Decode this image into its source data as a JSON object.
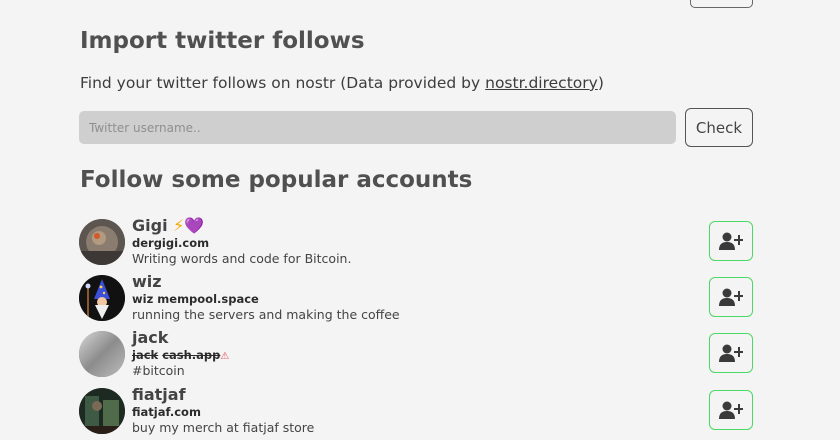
{
  "import": {
    "title": "Import twitter follows",
    "desc_prefix": "Find your twitter follows on nostr (Data provided by ",
    "desc_link": "nostr.directory",
    "desc_suffix": ")",
    "input_placeholder": "Twitter username..",
    "check_label": "Check"
  },
  "popular": {
    "title": "Follow some popular accounts",
    "accounts": [
      {
        "name": "Gigi",
        "name_emoji_1": "⚡",
        "name_emoji_2": "💜",
        "nip_user": "",
        "nip_domain": "dergigi.com",
        "nip_warning": "",
        "about": "Writing words and code for Bitcoin."
      },
      {
        "name": "wiz",
        "nip_user": "wiz",
        "nip_domain": "mempool.space",
        "nip_warning": "",
        "about": "running the servers and making the coffee"
      },
      {
        "name": "jack",
        "nip_user": "jack",
        "nip_domain": "cash.app",
        "nip_warning": "⚠",
        "about": "#bitcoin"
      },
      {
        "name": "fiatjaf",
        "nip_user": "",
        "nip_domain": "fiatjaf.com",
        "nip_warning": "",
        "about": "buy my merch at fiatjaf store"
      }
    ]
  },
  "colors": {
    "follow_border": "#4cd964",
    "background": "#f4f4f4",
    "input_bg": "#cfcfcf"
  },
  "icons": {
    "follow": "user-plus-icon"
  }
}
